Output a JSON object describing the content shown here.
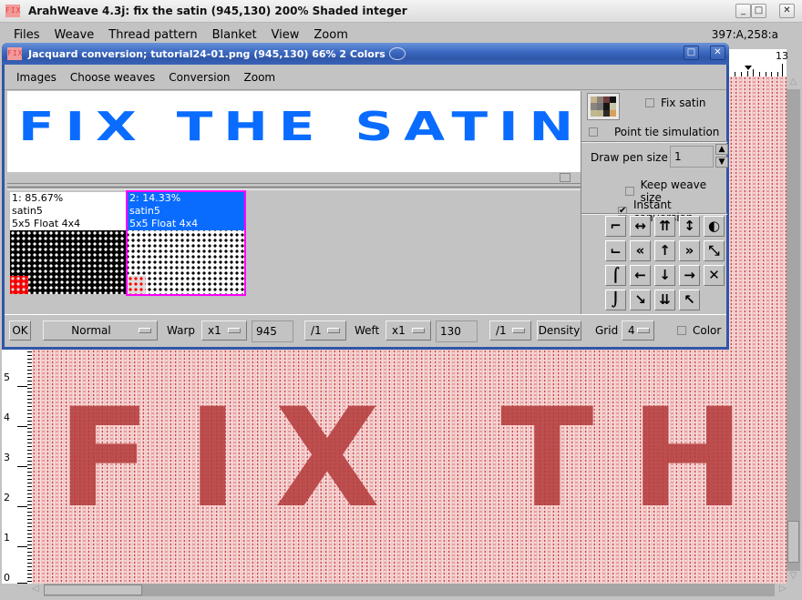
{
  "main_window": {
    "icon_text": "FIX",
    "title": "ArahWeave 4.3j: fix the satin (945,130) 200% Shaded integer",
    "buttons": {
      "minimize": "_",
      "maximize": "□",
      "close": "✕"
    },
    "menu": [
      "Files",
      "Weave",
      "Thread pattern",
      "Blanket",
      "View",
      "Zoom"
    ],
    "coord_readout": "397:A,258:a"
  },
  "workspace": {
    "top_ruler_label": "13",
    "left_ruler_labels": [
      "5",
      "4",
      "3",
      "2",
      "1",
      "0"
    ],
    "fabric_text": "FIX  TH",
    "fabric_colors": {
      "ground": "#f2c7c7",
      "figure": "#b43c3c"
    }
  },
  "dialog": {
    "icon_text": "FIX",
    "title": "Jacquard conversion; tutorial24-01.png (945,130) 66% 2 Colors",
    "buttons": {
      "maximize": "□",
      "close": "✕"
    },
    "menu": [
      "Images",
      "Choose weaves",
      "Conversion",
      "Zoom"
    ],
    "preview_text": "FIX THE SATIN",
    "preview_color": "#0a6cff",
    "weaves": [
      {
        "line1": "1: 85.67%",
        "line2": "satin5",
        "line3": "5x5 Float 4x4",
        "selected": false
      },
      {
        "line1": "2: 14.33%",
        "line2": "satin5",
        "line3": "5x5 Float 4x4",
        "selected": true
      }
    ],
    "side": {
      "palette_colors": [
        "#c8b28e",
        "#8a8278",
        "#6e3a3a",
        "#111111",
        "#8a8480",
        "#777777",
        "#151515",
        "#c8c4a8",
        "#c2b890",
        "#bcb48c",
        "#2a2a2a",
        "#d6a056"
      ],
      "fix_satin_label": "Fix satin",
      "fix_satin_checked": false,
      "point_tie_label": "Point tie simulation",
      "point_tie_checked": false,
      "draw_pen_label": "Draw pen size",
      "draw_pen_value": "1",
      "keep_weave_label": "Keep weave size",
      "keep_weave_checked": false,
      "instant_label": "Instant conversion",
      "instant_checked": true,
      "tool_icons": [
        {
          "name": "staircase-up-right-icon",
          "glyph": "⌐"
        },
        {
          "name": "move-horizontal-icon",
          "glyph": "↔"
        },
        {
          "name": "double-up-icon",
          "glyph": "⇈"
        },
        {
          "name": "move-vertical-icon",
          "glyph": "↕"
        },
        {
          "name": "invert-icon",
          "glyph": "◐"
        },
        {
          "name": "staircase-down-right-icon",
          "glyph": "⌙"
        },
        {
          "name": "double-left-icon",
          "glyph": "«"
        },
        {
          "name": "arrow-up-icon",
          "glyph": "↑"
        },
        {
          "name": "double-right-icon",
          "glyph": "»"
        },
        {
          "name": "diagonal-resize-icon",
          "glyph": "⤡"
        },
        {
          "name": "staircase-up-icon",
          "glyph": "⌠"
        },
        {
          "name": "arrow-left-icon",
          "glyph": "←"
        },
        {
          "name": "arrow-down-icon",
          "glyph": "↓"
        },
        {
          "name": "arrow-right-icon",
          "glyph": "→"
        },
        {
          "name": "clear-icon",
          "glyph": "✕"
        },
        {
          "name": "staircase-down-icon",
          "glyph": "⌡"
        },
        {
          "name": "fill-down-right-icon",
          "glyph": "↘"
        },
        {
          "name": "double-down-icon",
          "glyph": "⇊"
        },
        {
          "name": "fill-up-left-icon",
          "glyph": "↖"
        }
      ]
    },
    "bottom": {
      "ok_label": "OK",
      "mode_value": "Normal",
      "warp_label": "Warp",
      "warp_mult": "x1",
      "warp_value": "945",
      "warp_div": "/1",
      "weft_label": "Weft",
      "weft_mult": "x1",
      "weft_value": "130",
      "weft_div": "/1",
      "density_label": "Density",
      "grid_label": "Grid",
      "grid_value": "4",
      "color_label": "Color",
      "color_checked": false
    }
  }
}
